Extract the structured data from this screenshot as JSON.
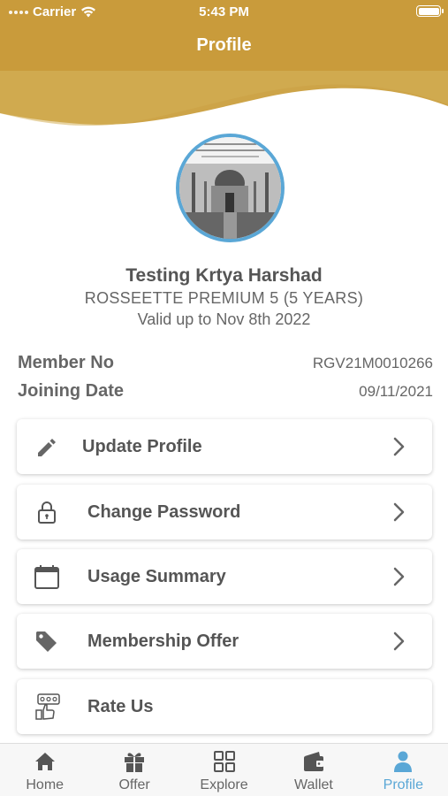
{
  "status_bar": {
    "carrier": "Carrier",
    "time": "5:43 PM"
  },
  "header": {
    "title": "Profile",
    "color": "#C9A040"
  },
  "profile": {
    "name": "Testing Krtya Harshad",
    "plan": "ROSSEETTE PREMIUM 5 (5 YEARS)",
    "validity": "Valid up to Nov 8th 2022"
  },
  "info": [
    {
      "label": "Member No",
      "value": "RGV21M0010266"
    },
    {
      "label": "Joining Date",
      "value": "09/11/2021"
    }
  ],
  "menu": [
    {
      "label": "Update Profile",
      "icon": "pencil-icon"
    },
    {
      "label": "Change Password",
      "icon": "lock-icon"
    },
    {
      "label": "Usage Summary",
      "icon": "calendar-icon"
    },
    {
      "label": "Membership Offer",
      "icon": "tag-icon"
    },
    {
      "label": "Rate Us",
      "icon": "rate-hand-icon"
    }
  ],
  "tabs": [
    {
      "label": "Home",
      "icon": "home-icon"
    },
    {
      "label": "Offer",
      "icon": "gift-icon"
    },
    {
      "label": "Explore",
      "icon": "grid-icon"
    },
    {
      "label": "Wallet",
      "icon": "wallet-icon"
    },
    {
      "label": "Profile",
      "icon": "person-icon",
      "active": true
    }
  ],
  "accent_color": "#5AA7D6"
}
